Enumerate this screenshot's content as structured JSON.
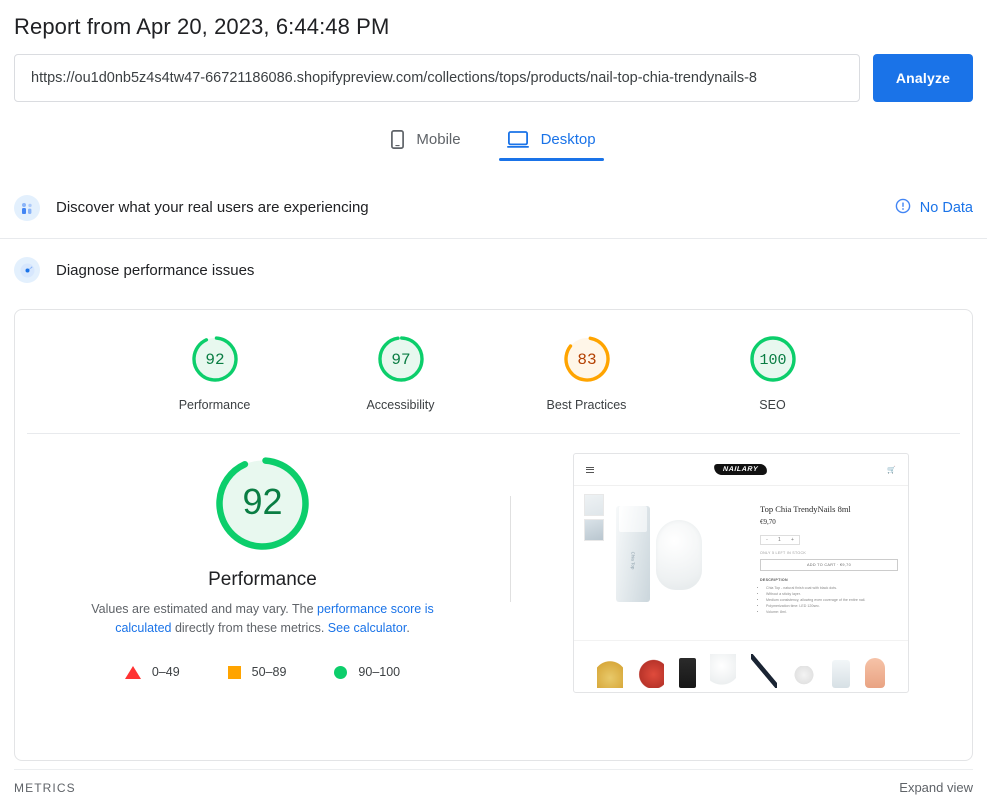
{
  "header": {
    "title": "Report from Apr 20, 2023, 6:44:48 PM",
    "url_value": "https://ou1d0nb5z4s4tw47-66721186086.shopifypreview.com/collections/tops/products/nail-top-chia-trendynails-8",
    "analyze_label": "Analyze"
  },
  "tabs": [
    {
      "label": "Mobile",
      "icon": "mobile-icon",
      "active": false
    },
    {
      "label": "Desktop",
      "icon": "desktop-icon",
      "active": true
    }
  ],
  "field_data": {
    "title": "Discover what your real users are experiencing",
    "icon": "users-icon",
    "status_label": "No Data",
    "status_icon": "info-circle-icon"
  },
  "lab_data": {
    "title": "Diagnose performance issues",
    "icon": "speedometer-icon"
  },
  "category_scores": [
    {
      "label": "Performance",
      "score": "92",
      "color": "#0cce6b",
      "fill": "#e8f8ef"
    },
    {
      "label": "Accessibility",
      "score": "97",
      "color": "#0cce6b",
      "fill": "#e8f8ef"
    },
    {
      "label": "Best Practices",
      "score": "83",
      "color": "#ffa400",
      "fill": "#fff6e8"
    },
    {
      "label": "SEO",
      "score": "100",
      "color": "#0cce6b",
      "fill": "#e8f8ef"
    }
  ],
  "performance": {
    "score": "92",
    "label": "Performance",
    "color": "#0cce6b",
    "fill": "#e8f8ef",
    "desc_part1": "Values are estimated and may vary. The ",
    "desc_link1": "performance score is calculated",
    "desc_part2": " directly from these metrics. ",
    "desc_link2": "See calculator",
    "desc_part3": "."
  },
  "legend": [
    {
      "shape": "triangle",
      "range": "0–49",
      "color": "#f33"
    },
    {
      "shape": "square",
      "range": "50–89",
      "color": "#ffa400"
    },
    {
      "shape": "circle",
      "range": "90–100",
      "color": "#0cce6b"
    }
  ],
  "thumbnail": {
    "logo": "NAILARY",
    "product_name": "Top Chia TrendyNails 8ml",
    "price": "€9,70",
    "qty_minus": "-",
    "qty_value": "1",
    "qty_plus": "+",
    "stock_note": "ONLY 5 LEFT IN STOCK",
    "cta": "ADD TO CART · €9,70",
    "desc_heading": "DESCRIPTION",
    "bullets": [
      "Chia Top - natural finish coat with black dots.",
      "Without a sticky layer.",
      "Medium consistency, allowing even coverage of the entire nail.",
      "Polymerization time: LED 120sec.",
      "Volume: 8ml."
    ]
  },
  "footer": {
    "metrics_label": "METRICS",
    "expand_label": "Expand view"
  }
}
